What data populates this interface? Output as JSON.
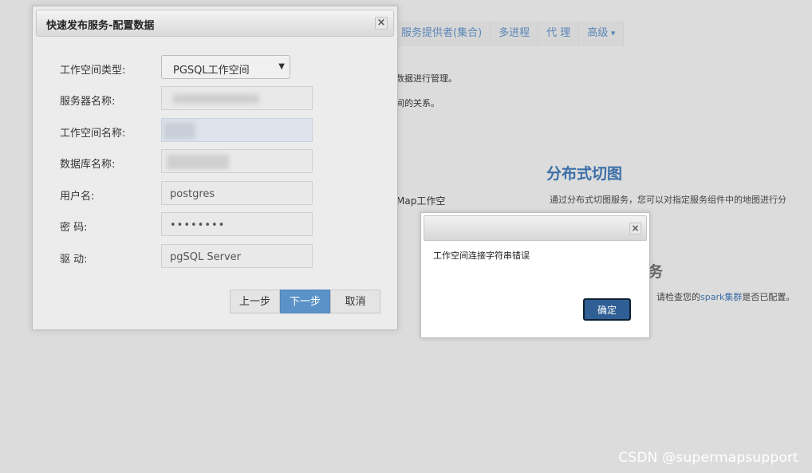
{
  "background": {
    "nav_items": [
      {
        "label": "服务提供者(集合)"
      },
      {
        "label": "多进程"
      },
      {
        "label": "代 理"
      },
      {
        "label": "高级",
        "dropdown": true
      }
    ],
    "text_line1": "数据进行管理。",
    "text_line2": "间的关系。",
    "map_workspace_text": "Map工作空",
    "distributed_tile_heading": "分布式切图",
    "distributed_tile_desc": "通过分布式切图服务，您可以对指定服务组件中的地图进行分",
    "service_heading": "务",
    "spark_prefix": "请检查您的",
    "spark_link": "spark集群",
    "spark_suffix": "是否已配置。"
  },
  "dialog": {
    "title": "快速发布服务-配置数据",
    "close_glyph": "×",
    "workspace_type_label": "工作空间类型:",
    "workspace_type_value": "PGSQL工作空间",
    "server_name_label": "服务器名称:",
    "server_name_value": "",
    "workspace_name_label": "工作空间名称:",
    "workspace_name_value": "",
    "database_name_label": "数据库名称:",
    "database_name_value": "",
    "username_label": "用户名:",
    "username_value": "postgres",
    "password_label": "密 码:",
    "password_value": "••••••••",
    "driver_label": "驱 动:",
    "driver_value": "pgSQL Server",
    "prev_button": "上一步",
    "next_button": "下一步",
    "cancel_button": "取消"
  },
  "alert": {
    "close_glyph": "×",
    "message": "工作空间连接字符串错误",
    "ok_button": "确定"
  },
  "watermark": "CSDN @supermapsupport",
  "colors": {
    "primary_button": "#5b93c8",
    "ok_button": "#2f5f95",
    "link": "#3b6ea8"
  }
}
